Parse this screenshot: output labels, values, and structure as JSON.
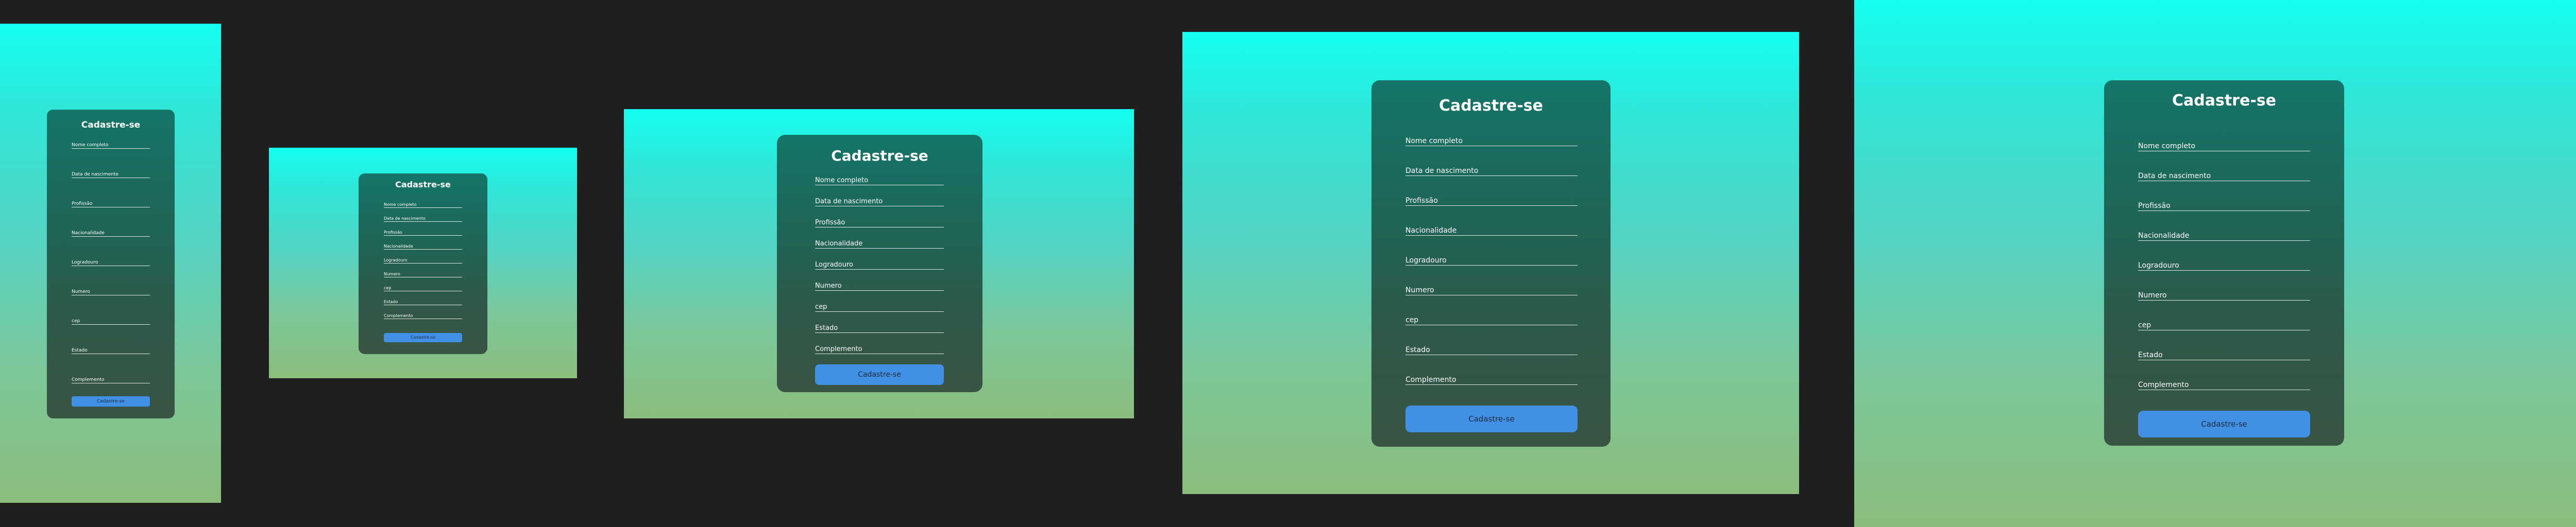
{
  "form": {
    "title": "Cadastre-se",
    "fields": [
      "Nome completo",
      "Data de nascimento",
      "Profissão",
      "Nacionalidade",
      "Logradouro",
      "Numero",
      "cep",
      "Estado",
      "Complemento"
    ],
    "submit_label": "Cadastre-se"
  },
  "colors": {
    "background": "#1f1f1f",
    "gradient_top": "#14fff0",
    "gradient_bottom": "#8abd7c",
    "card": "#1a6b5f",
    "button": "#4290e6",
    "text": "#ffffff"
  }
}
